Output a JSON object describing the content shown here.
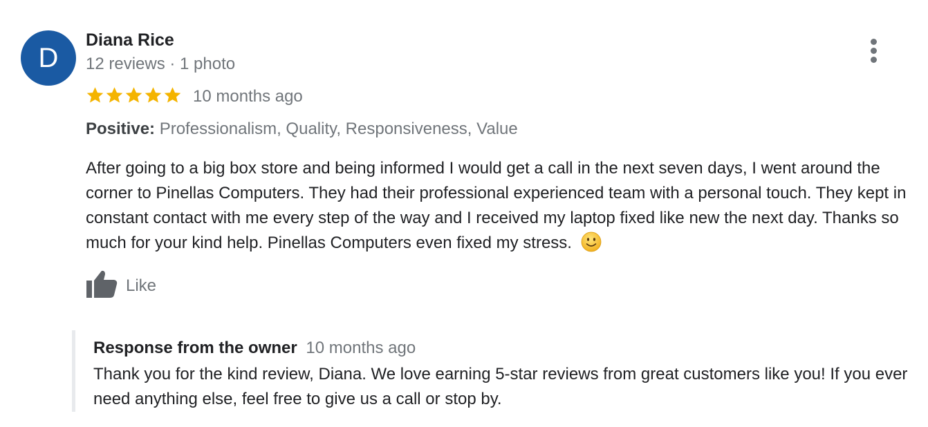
{
  "reviewer": {
    "initial": "D",
    "name": "Diana Rice",
    "meta": "12 reviews · 1 photo",
    "avatar_color": "#1a5aa3"
  },
  "rating": {
    "stars": 5,
    "max": 5,
    "star_color": "#f4b400"
  },
  "date": "10 months ago",
  "positive": {
    "label": "Positive:",
    "values": "Professionalism, Quality, Responsiveness, Value"
  },
  "review_text": "After going to a big box store and being informed I would get a call in the next seven days, I went around the corner to Pinellas Computers.  They had their professional experienced team with a personal touch. They kept in constant contact with me every step of the way and I received my laptop fixed like new the next day. Thanks so much for your kind help. Pinellas Computers even fixed my stress.",
  "review_emoji": "slightly-smiling-face-icon",
  "like": {
    "label": "Like",
    "icon": "thumbs-up-icon"
  },
  "more_icon": "more-vertical-icon",
  "owner_response": {
    "title": "Response from the owner",
    "date": "10 months ago",
    "text": "Thank you for the kind review, Diana. We love earning 5-star reviews from great customers like you! If you ever need anything else, feel free to give us a call or stop by."
  }
}
